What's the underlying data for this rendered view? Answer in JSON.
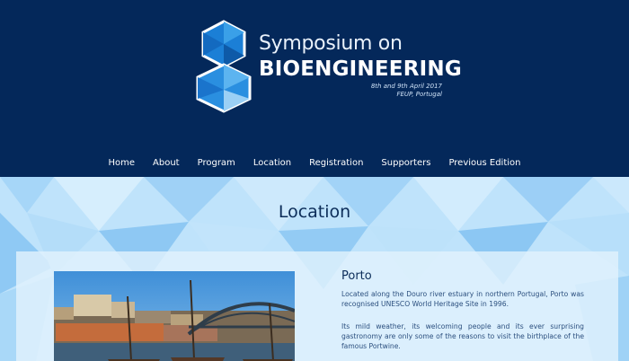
{
  "header": {
    "logo_line1": "Symposium on",
    "logo_line2": "BIOENGINEERING",
    "date_line": "8th and 9th April 2017",
    "place_line": "FEUP, Portugal"
  },
  "nav": {
    "items": [
      {
        "label": "Home"
      },
      {
        "label": "About"
      },
      {
        "label": "Program"
      },
      {
        "label": "Location"
      },
      {
        "label": "Registration"
      },
      {
        "label": "Supporters"
      },
      {
        "label": "Previous Edition"
      }
    ]
  },
  "main": {
    "title": "Location",
    "section_title": "Porto",
    "paragraph1": "Located along the Douro river estuary in northern Portugal, Porto was recognised UNESCO World Heritage Site in 1996.",
    "paragraph2": "Its mild weather, its welcoming people and its ever surprising gastronomy are only some of the reasons to visit the birthplace of the famous Portwine."
  },
  "colors": {
    "header_bg": "#04285a",
    "content_bg": "#bfe3fb",
    "title_text": "#0c2d59"
  }
}
